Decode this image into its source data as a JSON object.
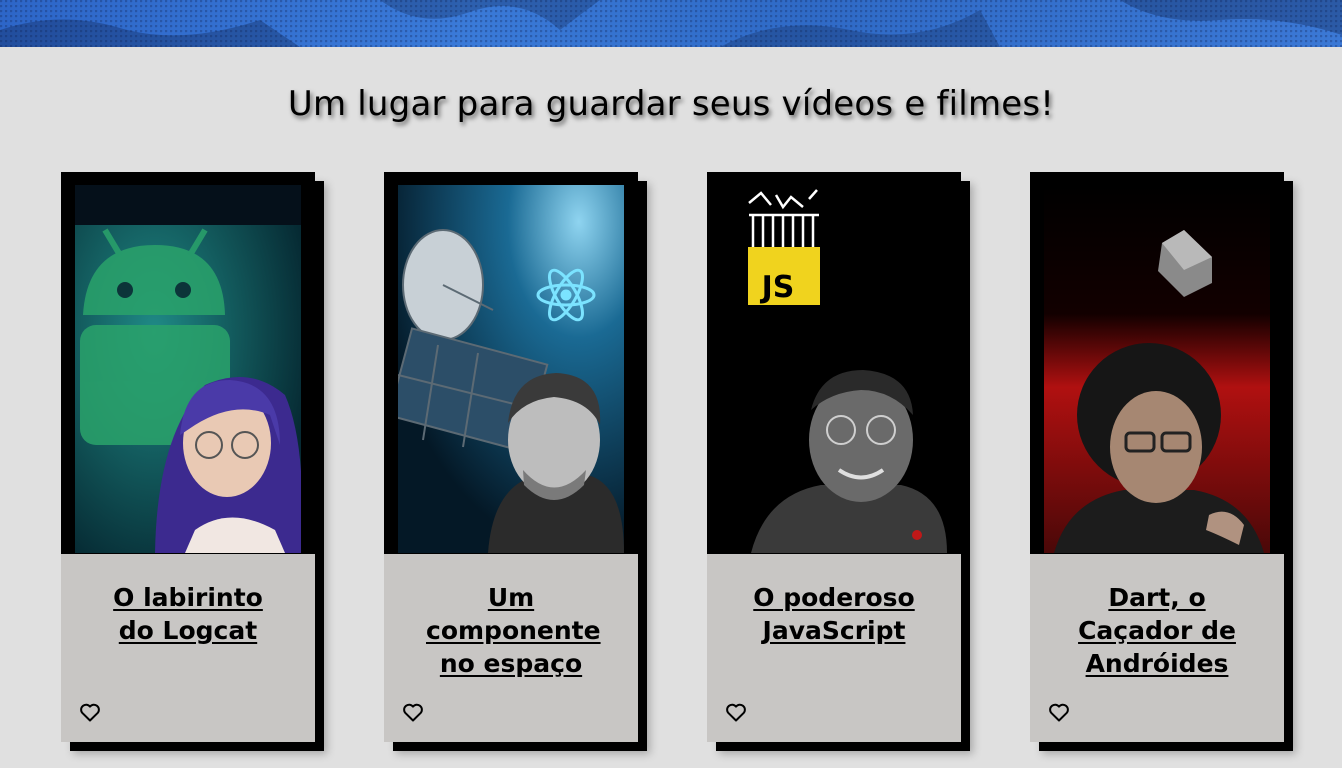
{
  "page": {
    "headline": "Um lugar para guardar seus vídeos e filmes!"
  },
  "colors": {
    "banner": "#3570d0",
    "background": "#e0e0e0",
    "card_info": "#c8c6c4",
    "card_frame": "#000000"
  },
  "videos": [
    {
      "title": "O labirinto do Logcat",
      "favorite_icon": "heart-outline-icon"
    },
    {
      "title": "Um componente no espaço",
      "favorite_icon": "heart-outline-icon"
    },
    {
      "title": "O poderoso JavaScript",
      "favorite_icon": "heart-outline-icon"
    },
    {
      "title": "Dart, o Caçador de Andróides",
      "favorite_icon": "heart-outline-icon"
    }
  ],
  "thumbnail_badges": {
    "js_badge": "JS"
  }
}
